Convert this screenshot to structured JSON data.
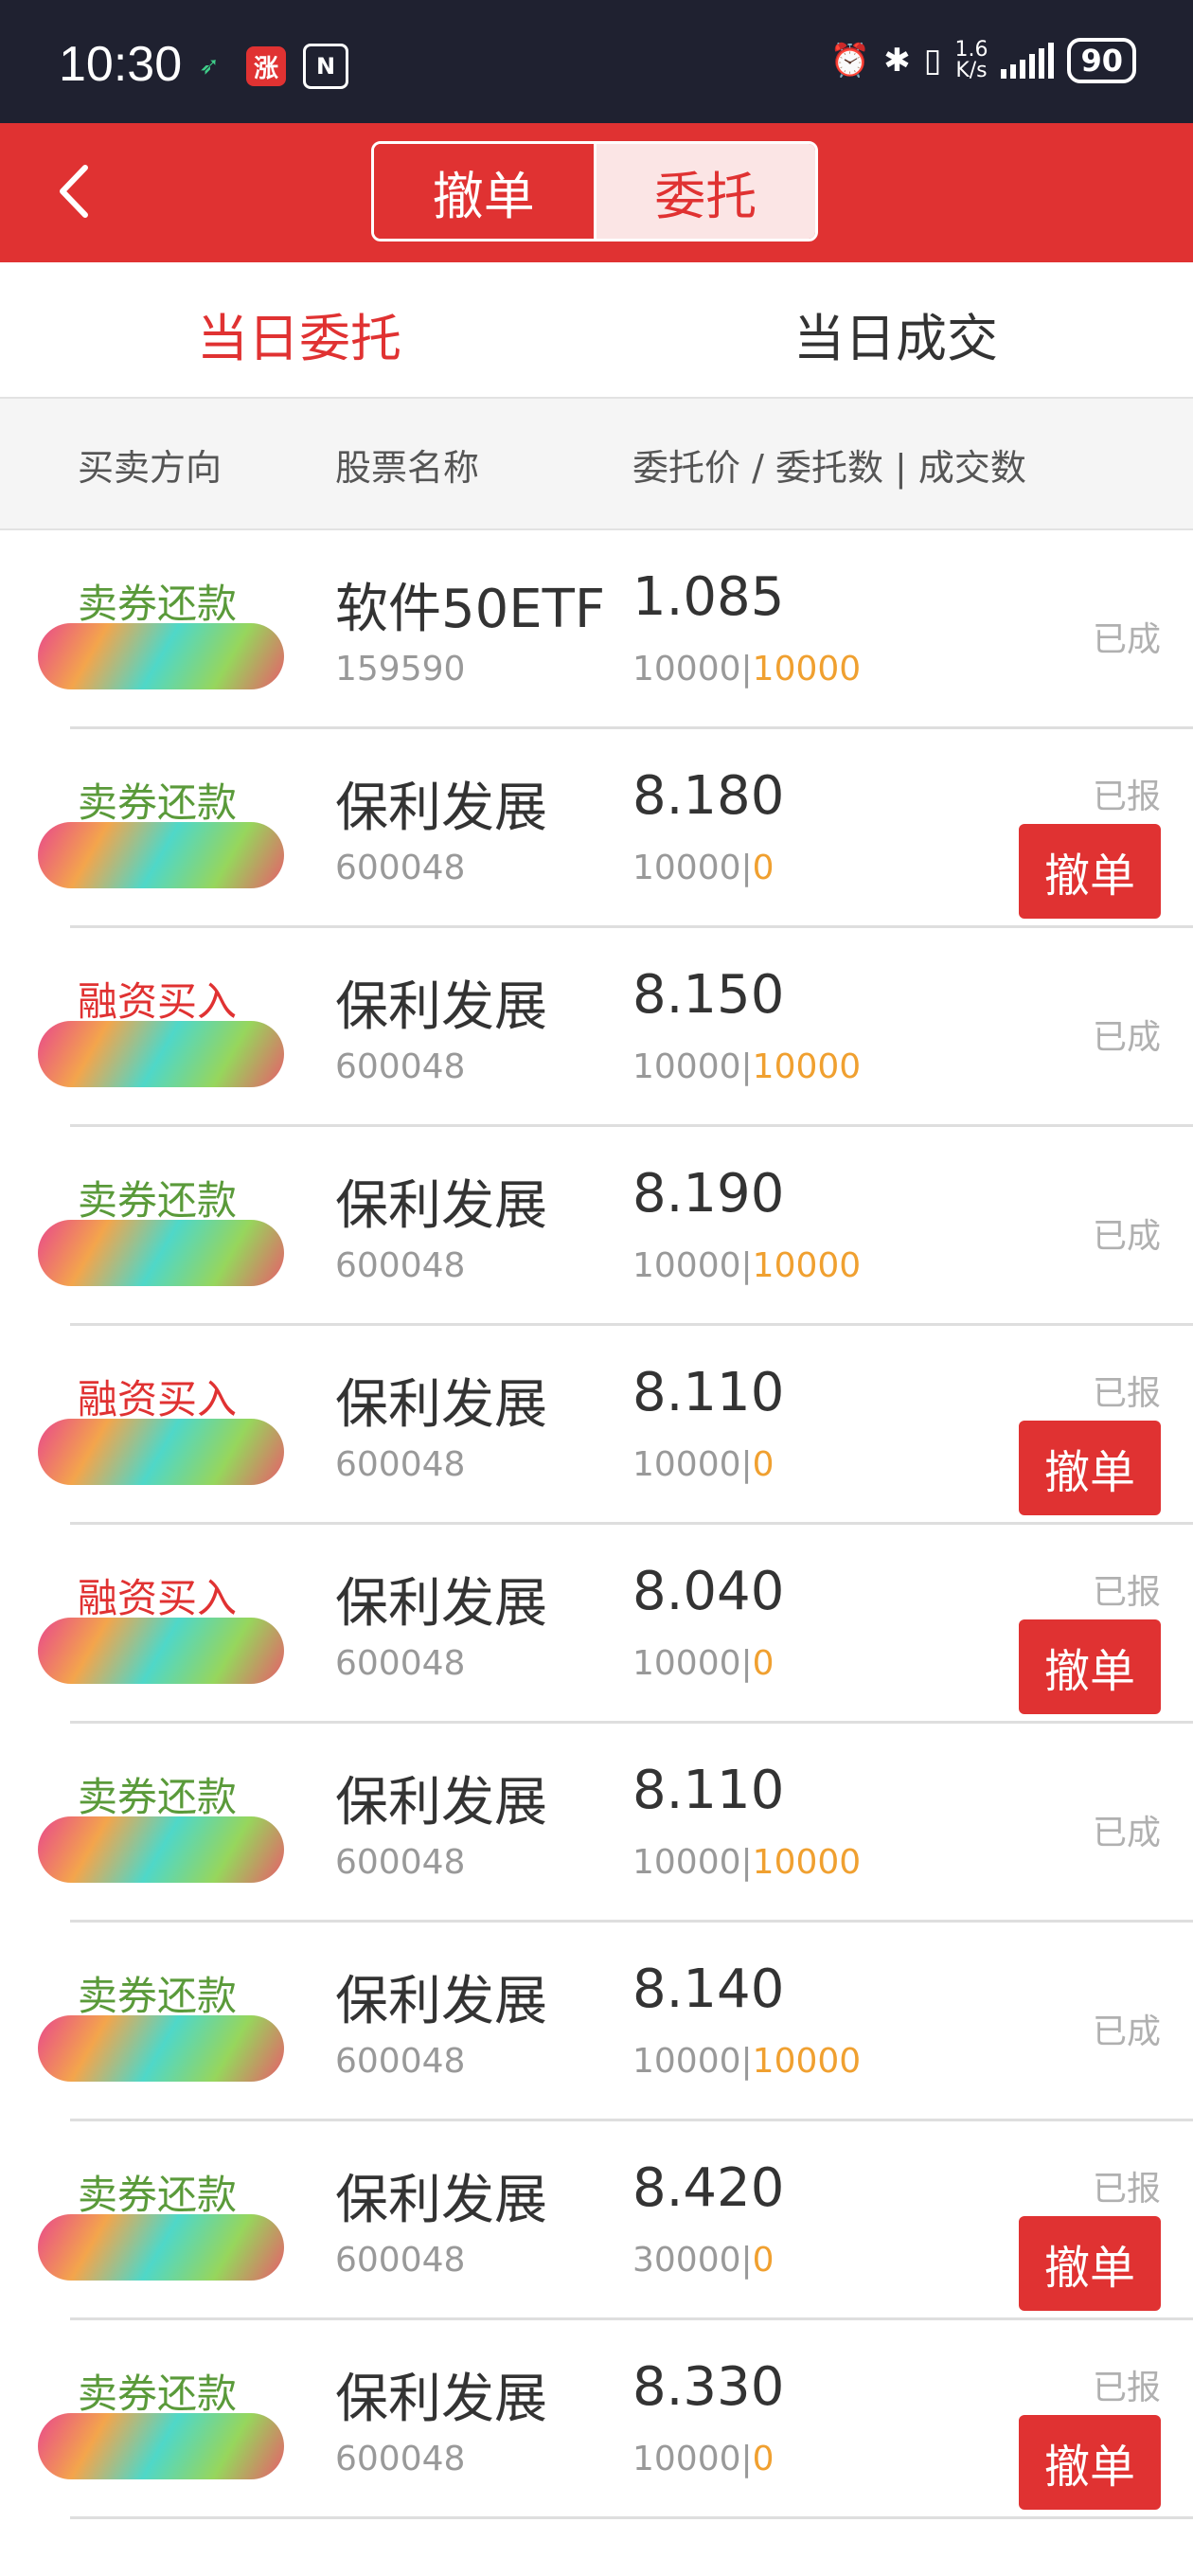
{
  "status_bar": {
    "time": "10:30",
    "net_speed_top": "1.6",
    "net_speed_bottom": "K/s",
    "battery": "90",
    "app_badge": "涨"
  },
  "header": {
    "seg_left": "撤单",
    "seg_right": "委托"
  },
  "tabs": {
    "today_orders": "当日委托",
    "today_trades": "当日成交"
  },
  "columns": {
    "direction": "买卖方向",
    "name": "股票名称",
    "price": "委托价 / 委托数 | 成交数"
  },
  "separator": "|",
  "colors": {
    "accent": "#e03232",
    "sell": "#5a9a3a",
    "filled_qty": "#f0a030"
  },
  "orders": [
    {
      "direction": "卖券还款",
      "name": "软件50ETF",
      "code": "159590",
      "price": "1.085",
      "qty": "10000",
      "filled": "10000",
      "status": "已成",
      "cancel": ""
    },
    {
      "direction": "卖券还款",
      "name": "保利发展",
      "code": "600048",
      "price": "8.180",
      "qty": "10000",
      "filled": "0",
      "status": "已报",
      "cancel": "撤单"
    },
    {
      "direction": "融资买入",
      "name": "保利发展",
      "code": "600048",
      "price": "8.150",
      "qty": "10000",
      "filled": "10000",
      "status": "已成",
      "cancel": ""
    },
    {
      "direction": "卖券还款",
      "name": "保利发展",
      "code": "600048",
      "price": "8.190",
      "qty": "10000",
      "filled": "10000",
      "status": "已成",
      "cancel": ""
    },
    {
      "direction": "融资买入",
      "name": "保利发展",
      "code": "600048",
      "price": "8.110",
      "qty": "10000",
      "filled": "0",
      "status": "已报",
      "cancel": "撤单"
    },
    {
      "direction": "融资买入",
      "name": "保利发展",
      "code": "600048",
      "price": "8.040",
      "qty": "10000",
      "filled": "0",
      "status": "已报",
      "cancel": "撤单"
    },
    {
      "direction": "卖券还款",
      "name": "保利发展",
      "code": "600048",
      "price": "8.110",
      "qty": "10000",
      "filled": "10000",
      "status": "已成",
      "cancel": ""
    },
    {
      "direction": "卖券还款",
      "name": "保利发展",
      "code": "600048",
      "price": "8.140",
      "qty": "10000",
      "filled": "10000",
      "status": "已成",
      "cancel": ""
    },
    {
      "direction": "卖券还款",
      "name": "保利发展",
      "code": "600048",
      "price": "8.420",
      "qty": "30000",
      "filled": "0",
      "status": "已报",
      "cancel": "撤单"
    },
    {
      "direction": "卖券还款",
      "name": "保利发展",
      "code": "600048",
      "price": "8.330",
      "qty": "10000",
      "filled": "0",
      "status": "已报",
      "cancel": "撤单"
    }
  ]
}
